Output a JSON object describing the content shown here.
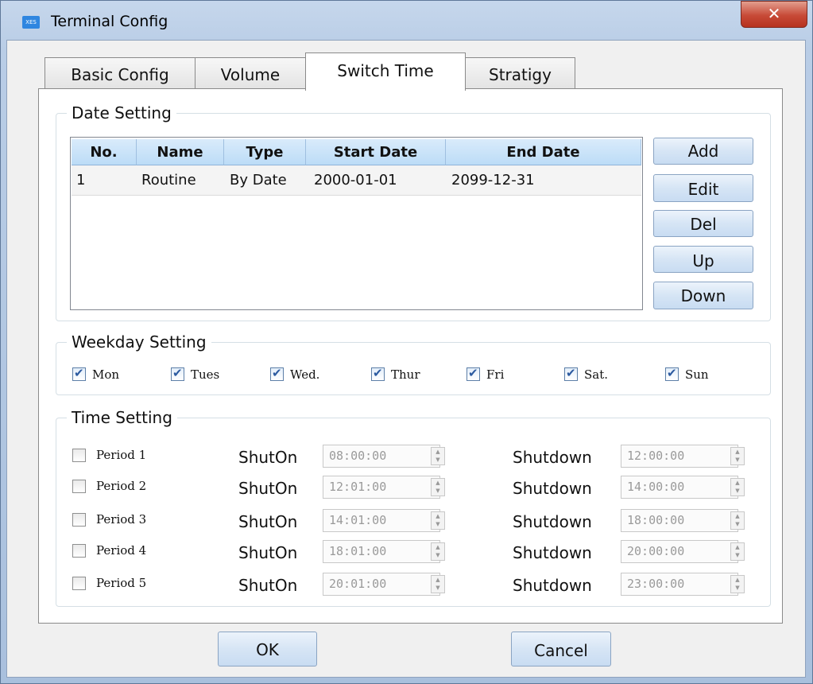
{
  "window": {
    "title": "Terminal Config",
    "app_icon_text": "XES",
    "close_glyph": "✕"
  },
  "tabs": [
    {
      "label": "Basic Config",
      "active": false
    },
    {
      "label": "Volume",
      "active": false
    },
    {
      "label": "Switch Time",
      "active": true
    },
    {
      "label": "Stratigy",
      "active": false
    }
  ],
  "date_setting": {
    "legend": "Date Setting",
    "columns": [
      "No.",
      "Name",
      "Type",
      "Start Date",
      "End Date"
    ],
    "rows": [
      {
        "no": "1",
        "name": "Routine",
        "type": "By Date",
        "start": "2000-01-01",
        "end": "2099-12-31"
      }
    ],
    "buttons": {
      "add": "Add",
      "edit": "Edit",
      "del": "Del",
      "up": "Up",
      "down": "Down"
    }
  },
  "weekday_setting": {
    "legend": "Weekday Setting",
    "days": [
      {
        "label": "Mon",
        "checked": true
      },
      {
        "label": "Tues",
        "checked": true
      },
      {
        "label": "Wed.",
        "checked": true
      },
      {
        "label": "Thur",
        "checked": true
      },
      {
        "label": "Fri",
        "checked": true
      },
      {
        "label": "Sat.",
        "checked": true
      },
      {
        "label": "Sun",
        "checked": true
      }
    ]
  },
  "time_setting": {
    "legend": "Time Setting",
    "shuton_label": "ShutOn",
    "shutdown_label": "Shutdown",
    "periods": [
      {
        "label": "Period 1",
        "checked": false,
        "shuton": "08:00:00",
        "shutdown": "12:00:00"
      },
      {
        "label": "Period 2",
        "checked": false,
        "shuton": "12:01:00",
        "shutdown": "14:00:00"
      },
      {
        "label": "Period 3",
        "checked": false,
        "shuton": "14:01:00",
        "shutdown": "18:00:00"
      },
      {
        "label": "Period 4",
        "checked": false,
        "shuton": "18:01:00",
        "shutdown": "20:00:00"
      },
      {
        "label": "Period 5",
        "checked": false,
        "shuton": "20:01:00",
        "shutdown": "23:00:00"
      }
    ]
  },
  "footer": {
    "ok": "OK",
    "cancel": "Cancel"
  }
}
